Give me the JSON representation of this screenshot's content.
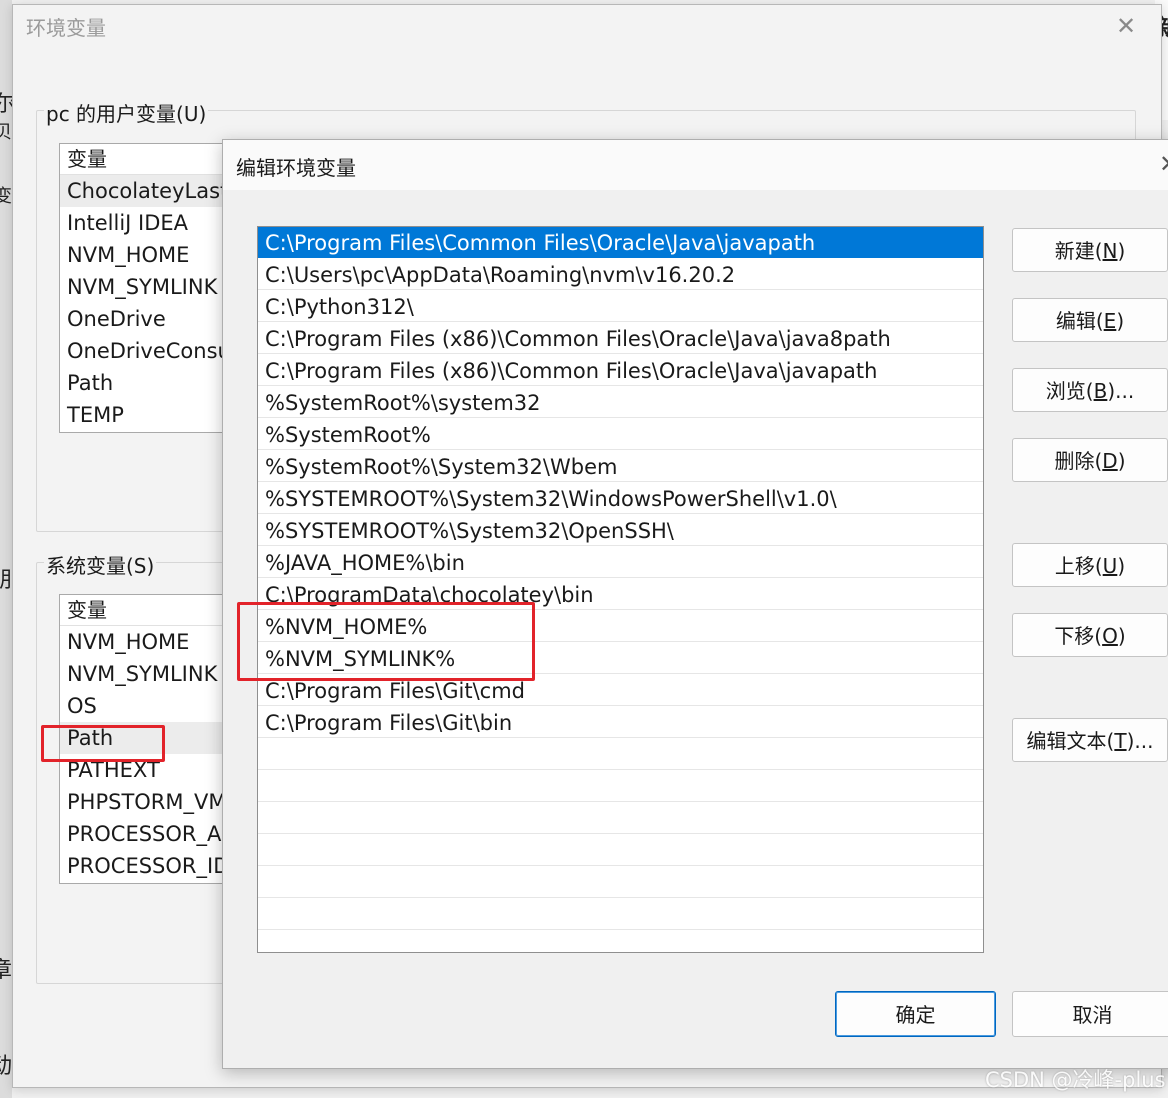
{
  "background": {
    "chars": [
      "尔",
      "贝",
      "变",
      "朋",
      "章",
      "动"
    ],
    "right_char": "新"
  },
  "outer_dialog": {
    "title": "环境变量",
    "user_vars": {
      "group_label": "pc 的用户变量(U)",
      "column_header": "变量",
      "rows": [
        "ChocolateyLast",
        "IntelliJ IDEA",
        "NVM_HOME",
        "NVM_SYMLINK",
        "OneDrive",
        "OneDriveConsu",
        "Path",
        "TEMP"
      ]
    },
    "system_vars": {
      "group_label": "系统变量(S)",
      "column_header": "变量",
      "rows": [
        "NVM_HOME",
        "NVM_SYMLINK",
        "OS",
        "Path",
        "PATHEXT",
        "PHPSTORM_VM",
        "PROCESSOR_AF",
        "PROCESSOR_ID"
      ],
      "highlighted_row": "Path"
    }
  },
  "edit_dialog": {
    "title": "编辑环境变量",
    "paths": [
      "C:\\Program Files\\Common Files\\Oracle\\Java\\javapath",
      "C:\\Users\\pc\\AppData\\Roaming\\nvm\\v16.20.2",
      "C:\\Python312\\",
      "C:\\Program Files (x86)\\Common Files\\Oracle\\Java\\java8path",
      "C:\\Program Files (x86)\\Common Files\\Oracle\\Java\\javapath",
      "%SystemRoot%\\system32",
      "%SystemRoot%",
      "%SystemRoot%\\System32\\Wbem",
      "%SYSTEMROOT%\\System32\\WindowsPowerShell\\v1.0\\",
      "%SYSTEMROOT%\\System32\\OpenSSH\\",
      "%JAVA_HOME%\\bin",
      "C:\\ProgramData\\chocolatey\\bin",
      "%NVM_HOME%",
      "%NVM_SYMLINK%",
      "C:\\Program Files\\Git\\cmd",
      "C:\\Program Files\\Git\\bin"
    ],
    "selected_path": "C:\\Program Files\\Common Files\\Oracle\\Java\\javapath",
    "buttons": {
      "new": {
        "label": "新建(",
        "key": "N",
        "suffix": ")"
      },
      "edit": {
        "label": "编辑(",
        "key": "E",
        "suffix": ")"
      },
      "browse": {
        "label": "浏览(",
        "key": "B",
        "suffix": ")..."
      },
      "delete": {
        "label": "删除(",
        "key": "D",
        "suffix": ")"
      },
      "move_up": {
        "label": "上移(",
        "key": "U",
        "suffix": ")"
      },
      "move_down": {
        "label": "下移(",
        "key": "O",
        "suffix": ")"
      },
      "edit_text": {
        "label": "编辑文本(",
        "key": "T",
        "suffix": ")..."
      },
      "ok": "确定",
      "cancel": "取消"
    }
  },
  "watermark": "CSDN @冷峰-plus",
  "colors": {
    "selection": "#0078d7",
    "highlight_box": "#e2232a"
  }
}
